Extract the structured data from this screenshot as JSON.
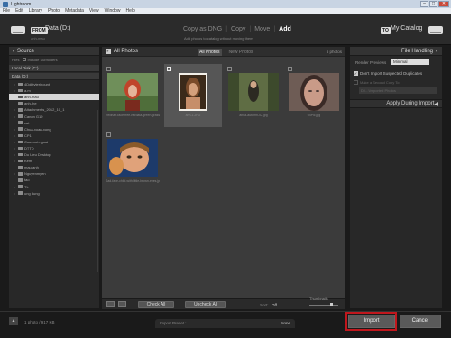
{
  "window": {
    "title": "Lightroom",
    "controls": [
      "–",
      "□",
      "✕"
    ]
  },
  "menu": [
    "File",
    "Edit",
    "Library",
    "Photo",
    "Metadata",
    "View",
    "Window",
    "Help"
  ],
  "top": {
    "from_badge": "FROM",
    "from_name": "Data (D:)",
    "from_sub": "anh-mau",
    "modes": [
      "Copy as DNG",
      "Copy",
      "Move",
      "Add"
    ],
    "active_mode": "Add",
    "mode_desc": "Add photos to catalog without moving them",
    "to_badge": "TO",
    "to_name": "My Catalog"
  },
  "source": {
    "title": "Source",
    "files_label": "Files",
    "subfolders_label": "Include Subfolders",
    "disk1": "Local Disk (C:)",
    "disk2": "Data (D:)",
    "folders": [
      "4Ddittvterinount",
      "a.m",
      "anh-mau",
      "anh-the",
      "Attachments_2012_10_1",
      "Canon G19",
      "cat",
      "Chua-xoan-xong",
      "CP1",
      "Cua-moi-ngoai",
      "DTTD",
      "Du Lieu Desktop",
      "Kem",
      "mau-anh",
      "Nguyenmyen",
      "tao",
      "TL",
      "ung dung"
    ],
    "selected_folder": "anh-mau"
  },
  "grid": {
    "header_label": "All Photos",
    "tabs": [
      "All Photos",
      "New Photos"
    ],
    "count": "5 photos",
    "captions": [
      "Redhair-face-free-hardata-green-grass.jpg",
      "anh-1.JPG",
      "anna-autumn-02.jpg",
      "04Pic.jpg",
      "Sad-face-child-with-little-brown-eyes.jpg"
    ]
  },
  "toolbar": {
    "check_all": "Check All",
    "uncheck_all": "Uncheck All",
    "sort_label": "Sort:",
    "sort_value": "Off",
    "thumbnails_label": "Thumbnails",
    "thumbnail_size": 0.8
  },
  "right": {
    "file_handling": "File Handling",
    "render_label": "Render Previews",
    "render_value": "Minimal",
    "dont_import_dup": "Don't Import Suspected Duplicates",
    "second_copy": "Make a Second Copy To:",
    "copy_dest": "D:\\...\\Imported Photos",
    "apply_during_import": "Apply During Import"
  },
  "footer": {
    "info": "1 photo / 917 KB",
    "preset_label": "Import Preset :",
    "preset_value": "None",
    "import": "Import",
    "cancel": "Cancel"
  },
  "colors": {
    "highlight": "#c0171d",
    "panel": "#282828",
    "grid_bg": "#3b3b3b"
  }
}
